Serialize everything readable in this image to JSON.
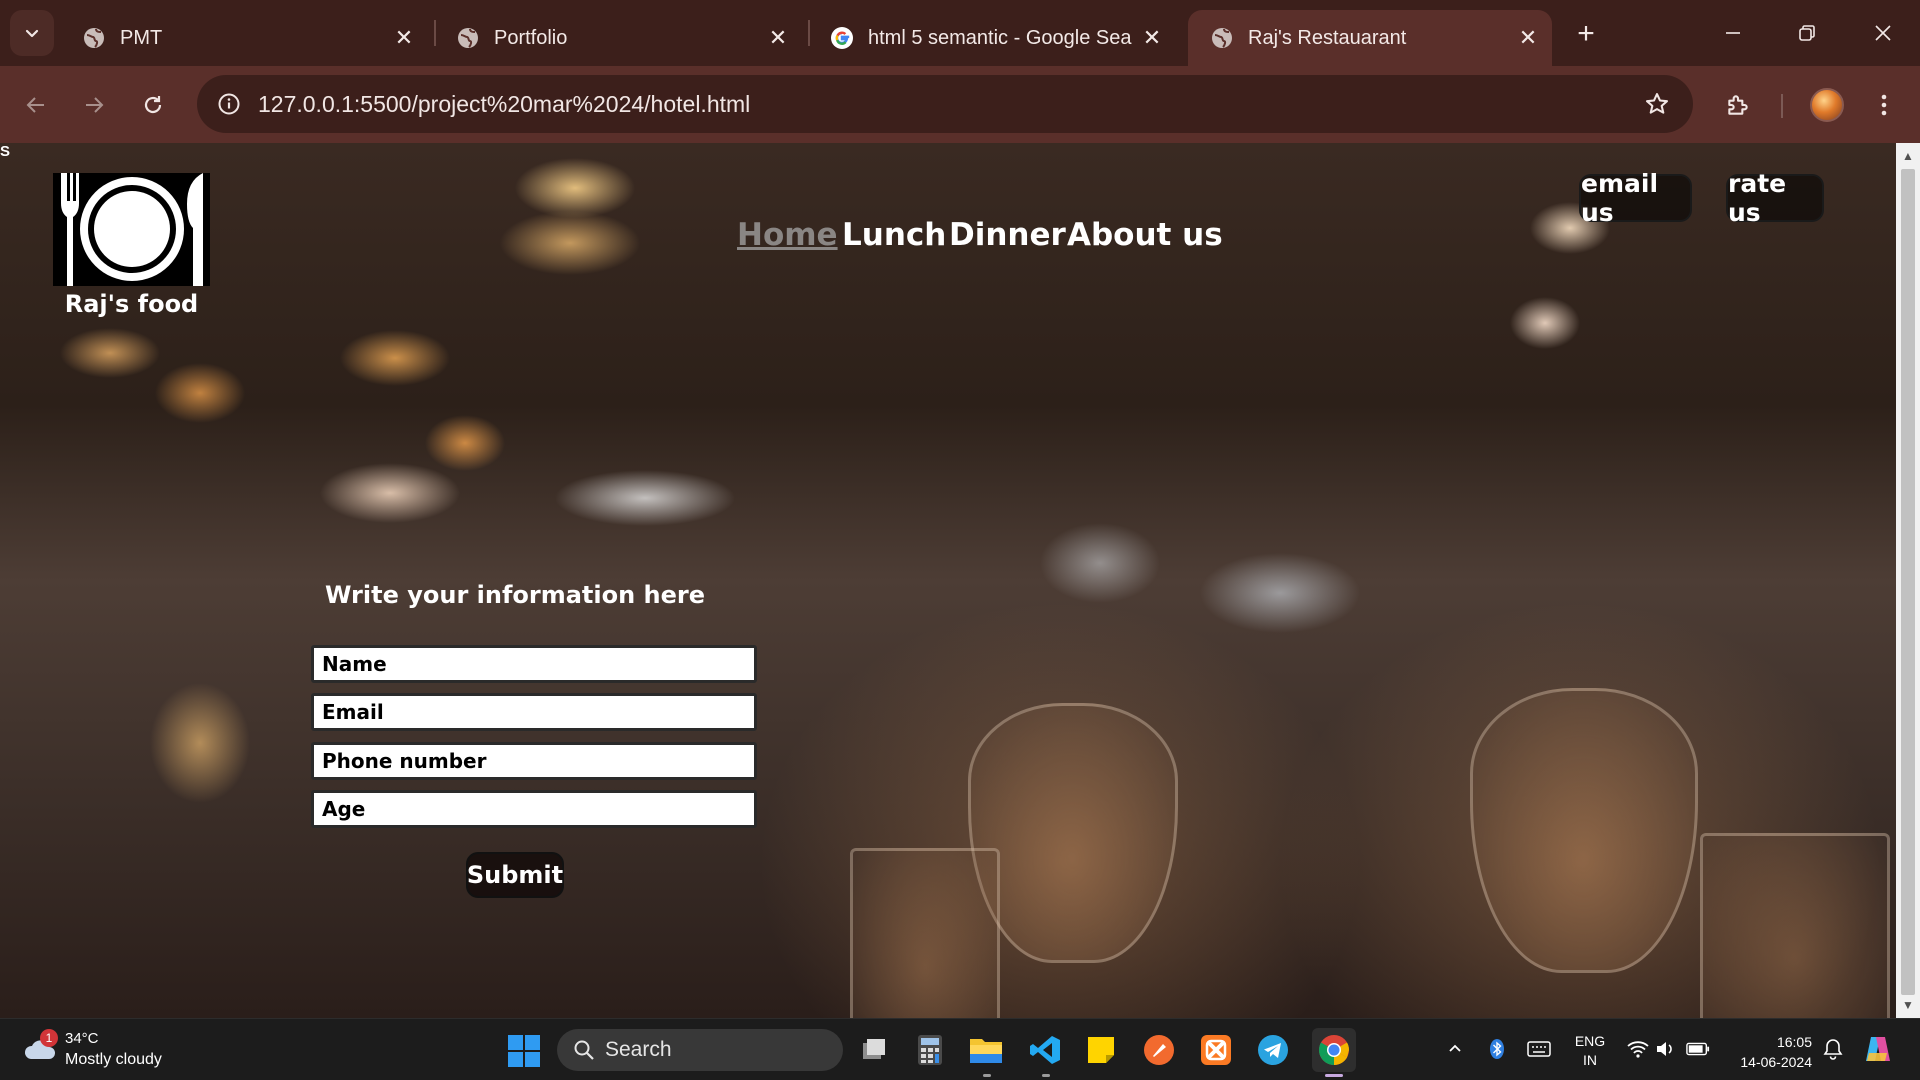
{
  "browser": {
    "tabs": [
      {
        "title": "PMT",
        "favicon": "globe-icon",
        "active": false
      },
      {
        "title": "Portfolio",
        "favicon": "globe-icon",
        "active": false
      },
      {
        "title": "html 5 semantic - Google Sea",
        "favicon": "google-icon",
        "active": false
      },
      {
        "title": "Raj's Restauarant",
        "favicon": "globe-icon",
        "active": true
      }
    ],
    "url": "127.0.0.1:5500/project%20mar%2024/hotel.html"
  },
  "page": {
    "corner_text": "S",
    "logo_name": "Raj's food",
    "nav": [
      {
        "label": "Home",
        "active": true
      },
      {
        "label": "Lunch",
        "active": false
      },
      {
        "label": "Dinner",
        "active": false
      },
      {
        "label": "About us",
        "active": false
      }
    ],
    "email_button": "email us",
    "rate_button": "rate us",
    "form": {
      "heading": "Write your information here",
      "fields": [
        {
          "placeholder": "Name",
          "value": ""
        },
        {
          "placeholder": "Email",
          "value": ""
        },
        {
          "placeholder": "Phone number",
          "value": ""
        },
        {
          "placeholder": "Age",
          "value": ""
        }
      ],
      "submit_label": "Submit"
    }
  },
  "taskbar": {
    "weather": {
      "temp": "34°C",
      "desc": "Mostly cloudy",
      "badge": "1"
    },
    "search_label": "Search",
    "language": {
      "line1": "ENG",
      "line2": "IN"
    },
    "clock": {
      "time": "16:05",
      "date": "14-06-2024"
    }
  },
  "colors": {
    "tab_strip": "#3c1f1b",
    "toolbar": "#5a2f2a",
    "nav_active": "#8a8684",
    "windows_blue": "#2f9bf2"
  }
}
